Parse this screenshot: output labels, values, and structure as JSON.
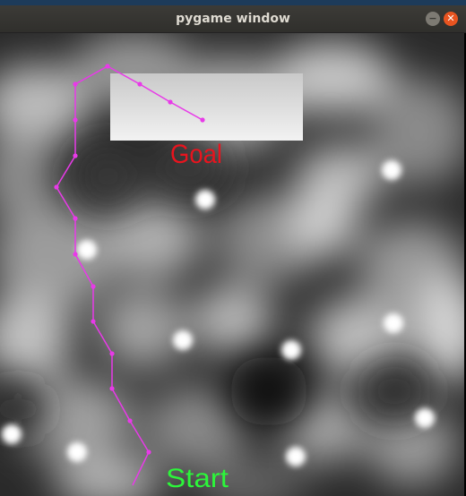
{
  "window": {
    "title": "pygame window",
    "minimize_glyph": "−",
    "close_glyph": "✕"
  },
  "scene": {
    "goal_label": "Goal",
    "start_label": "Start",
    "goal_color": "#e8141e",
    "start_color": "#2cf53a",
    "path_color": "#e83ae8"
  }
}
